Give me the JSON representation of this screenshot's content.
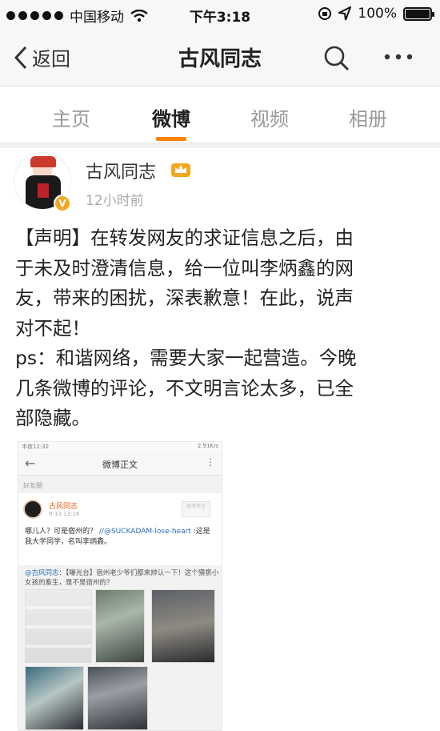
{
  "status_bar": {
    "carrier": "中国移动",
    "time": "下午3:18",
    "battery": "100%",
    "battery_level": 1.0
  },
  "nav": {
    "back_label": "返回",
    "title": "古风同志",
    "icons": [
      "chevron-left-icon",
      "search-icon",
      "more-icon"
    ]
  },
  "tabs": [
    {
      "label": "主页",
      "active": false
    },
    {
      "label": "微博",
      "active": true
    },
    {
      "label": "视频",
      "active": false
    },
    {
      "label": "相册",
      "active": false
    }
  ],
  "colors": {
    "accent": "#ff8200",
    "link": "#2a6fbd",
    "verified": "#f5a623"
  },
  "post": {
    "username": "古风同志",
    "verified_mark": "V",
    "time": "12小时前",
    "text_lines": [
      "【声明】在转发网友的求证信息之后，由",
      "于未及时澄清信息，给一位叫李炳鑫的网",
      "友，带来的困扰，深表歉意！在此，说声",
      "对不起！",
      "ps：和谐网络，需要大家一起营造。今晚",
      "几条微博的评论，不文明言论太多，已全",
      "部隐藏。"
    ]
  },
  "embedded_screenshot": {
    "status_time": "半夜12:32",
    "status_right": "2.91K/s",
    "title": "微博正文",
    "section_label": "好友圈",
    "author": "古风同志",
    "time": "8-13 13:16",
    "follow_label": "取消关注",
    "text_prefix": "哪儿人？可是宿州的？",
    "mention": "//@SUCKADAM-lose-heart",
    "text_suffix": ":这是我大学同学，名叫李炳鑫。",
    "repost_mention": "@古风同志",
    "repost_text": "：【曝光台】宿州老少爷们都来辨认一下！这个猥亵小女孩的畜生，是不是宿州的？"
  }
}
